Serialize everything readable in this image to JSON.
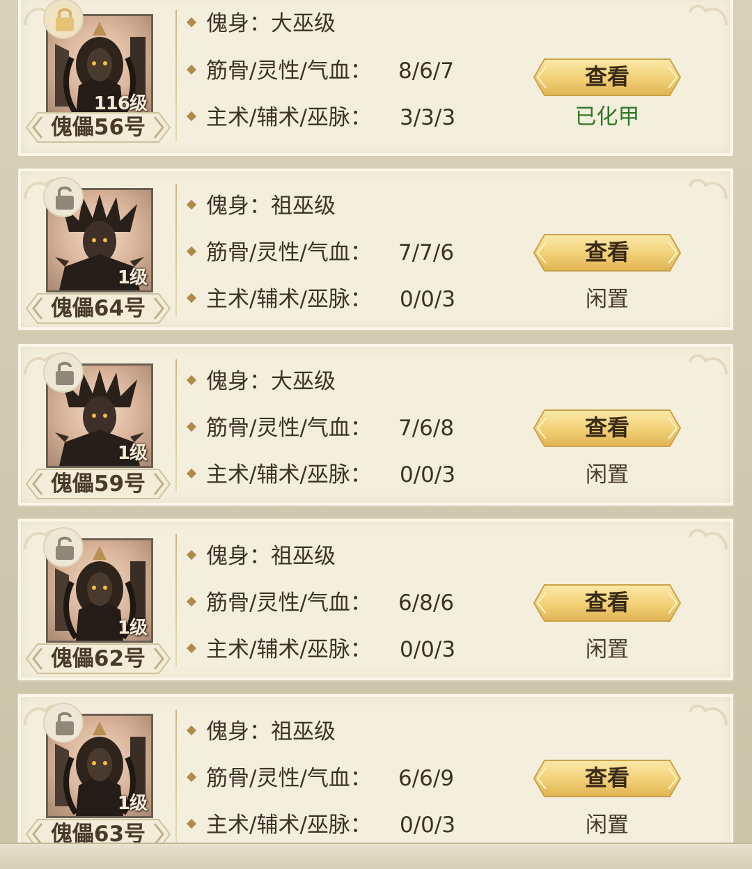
{
  "labels": {
    "body_type_prefix": "傀身：",
    "stats_label": "筋骨/灵性/气血：",
    "skills_label": "主术/辅术/巫脉：",
    "view_button": "查看"
  },
  "colors": {
    "card_bg": "#f4eedd",
    "button_gold": "#f2d27a",
    "armored_status": "#2f7a28",
    "text": "#3e3226"
  },
  "puppets": [
    {
      "name": "傀儡56号",
      "level": "116级",
      "body_type": "大巫级",
      "stats": "8/6/7",
      "skills": "3/3/3",
      "status": "已化甲",
      "locked": true,
      "portrait_icon": "female-warrior-portrait"
    },
    {
      "name": "傀儡64号",
      "level": "1级",
      "body_type": "祖巫级",
      "stats": "7/7/6",
      "skills": "0/0/3",
      "status": "闲置",
      "locked": false,
      "portrait_icon": "flame-haired-warrior-portrait"
    },
    {
      "name": "傀儡59号",
      "level": "1级",
      "body_type": "大巫级",
      "stats": "7/6/8",
      "skills": "0/0/3",
      "status": "闲置",
      "locked": false,
      "portrait_icon": "flame-haired-warrior-portrait"
    },
    {
      "name": "傀儡62号",
      "level": "1级",
      "body_type": "祖巫级",
      "stats": "6/8/6",
      "skills": "0/0/3",
      "status": "闲置",
      "locked": false,
      "portrait_icon": "female-warrior-portrait"
    },
    {
      "name": "傀儡63号",
      "level": "1级",
      "body_type": "祖巫级",
      "stats": "6/6/9",
      "skills": "0/0/3",
      "status": "闲置",
      "locked": false,
      "portrait_icon": "female-warrior-portrait"
    }
  ]
}
